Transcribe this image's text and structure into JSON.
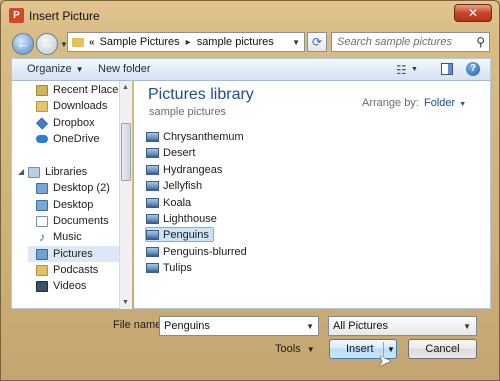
{
  "window": {
    "title": "Insert Picture",
    "app_icon_letter": "P",
    "close_glyph": "✕"
  },
  "address": {
    "chevron": "«",
    "crumbs": [
      "Sample Pictures",
      "sample pictures"
    ],
    "separator": "▸"
  },
  "search": {
    "placeholder": "Search sample pictures"
  },
  "toolbar": {
    "organize_label": "Organize",
    "new_folder_label": "New folder",
    "help_label": "?"
  },
  "nav_pane": {
    "items": [
      {
        "label": "Recent Places",
        "icon": "recent-places-icon"
      },
      {
        "label": "Downloads",
        "icon": "folder-icon"
      },
      {
        "label": "Dropbox",
        "icon": "dropbox-icon"
      },
      {
        "label": "OneDrive",
        "icon": "onedrive-icon"
      },
      {
        "label": "Libraries",
        "icon": "libraries-icon"
      },
      {
        "label": "Desktop (2)",
        "icon": "desktop-icon"
      },
      {
        "label": "Desktop",
        "icon": "desktop-icon"
      },
      {
        "label": "Documents",
        "icon": "documents-icon"
      },
      {
        "label": "Music",
        "icon": "music-icon"
      },
      {
        "label": "Pictures",
        "icon": "pictures-icon",
        "selected": true
      },
      {
        "label": "Podcasts",
        "icon": "folder-icon"
      },
      {
        "label": "Videos",
        "icon": "videos-icon"
      }
    ]
  },
  "library": {
    "title": "Pictures library",
    "subtitle": "sample pictures",
    "arrange_label": "Arrange by:",
    "arrange_value": "Folder"
  },
  "files": [
    {
      "name": "Chrysanthemum"
    },
    {
      "name": "Desert"
    },
    {
      "name": "Hydrangeas"
    },
    {
      "name": "Jellyfish"
    },
    {
      "name": "Koala"
    },
    {
      "name": "Lighthouse"
    },
    {
      "name": "Penguins",
      "selected": true
    },
    {
      "name": "Penguins-blurred"
    },
    {
      "name": "Tulips"
    }
  ],
  "bottom": {
    "file_name_label": "File name:",
    "file_name_value": "Penguins",
    "file_type_value": "All Pictures",
    "tools_label": "Tools",
    "insert_label": "Insert",
    "cancel_label": "Cancel"
  }
}
